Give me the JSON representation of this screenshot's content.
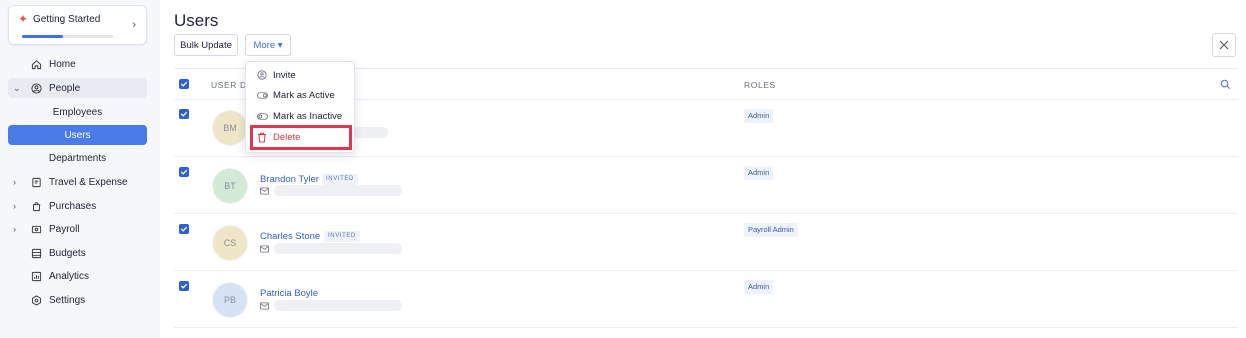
{
  "sidebar": {
    "getting_started": {
      "label": "Getting Started",
      "progress": 0.45
    },
    "items": [
      {
        "label": "Home",
        "icon": "home-icon"
      },
      {
        "label": "People",
        "icon": "people-icon",
        "expanded": true
      },
      {
        "label": "Employees"
      },
      {
        "label": "Users",
        "active": true
      },
      {
        "label": "Departments"
      },
      {
        "label": "Travel & Expense",
        "icon": "receipt-icon"
      },
      {
        "label": "Purchases",
        "icon": "bag-icon"
      },
      {
        "label": "Payroll",
        "icon": "payroll-icon"
      },
      {
        "label": "Budgets",
        "icon": "budget-icon"
      },
      {
        "label": "Analytics",
        "icon": "analytics-icon"
      },
      {
        "label": "Settings",
        "icon": "gear-icon"
      }
    ]
  },
  "header": {
    "title": "Users",
    "bulk_update_label": "Bulk Update",
    "more_label": "More ▾"
  },
  "table": {
    "columns": {
      "user": "USER D",
      "roles": "ROLES"
    },
    "rows": [
      {
        "initials": "BM",
        "name": "",
        "badge": "",
        "role": "Admin",
        "avatar_color": "#efe6c7"
      },
      {
        "initials": "BT",
        "name": "Brandon Tyler",
        "badge": "INVITED",
        "role": "Admin",
        "avatar_color": "#d3ead7"
      },
      {
        "initials": "CS",
        "name": "Charles Stone",
        "badge": "INVITED",
        "role": "Payroll Admin",
        "avatar_color": "#efe6c7"
      },
      {
        "initials": "PB",
        "name": "Patricia Boyle",
        "badge": "",
        "role": "Admin",
        "avatar_color": "#d5e3f5"
      }
    ]
  },
  "dropdown": {
    "items": [
      {
        "label": "Invite",
        "icon": "invite-icon"
      },
      {
        "label": "Mark as Active",
        "icon": "toggle-on-icon"
      },
      {
        "label": "Mark as Inactive",
        "icon": "toggle-off-icon"
      },
      {
        "label": "Delete",
        "icon": "trash-icon",
        "danger": true
      }
    ]
  },
  "colors": {
    "accent": "#3f6ee6",
    "active_nav": "#4a7be8",
    "danger": "#d93b3b",
    "highlight": "#e0364f"
  }
}
